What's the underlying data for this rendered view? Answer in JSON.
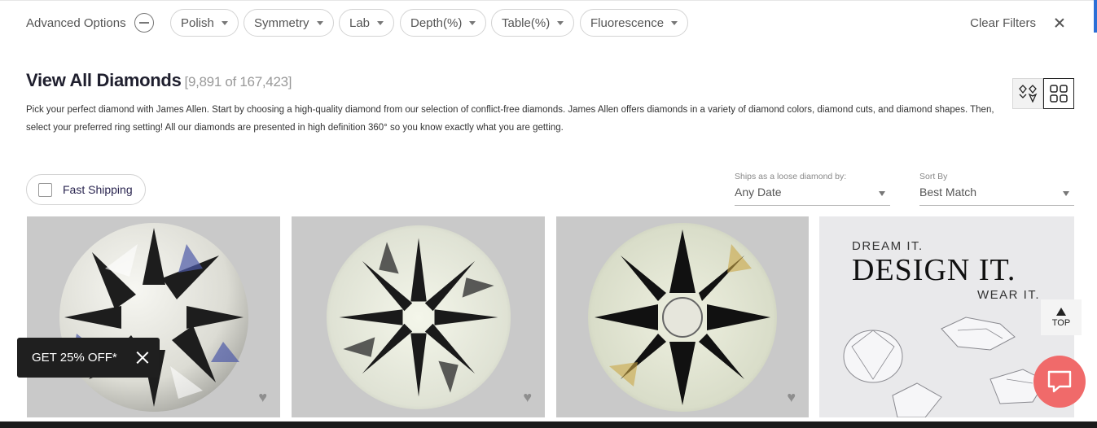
{
  "filters": {
    "advanced_label": "Advanced Options",
    "pills": [
      "Polish",
      "Symmetry",
      "Lab",
      "Depth(%)",
      "Table(%)",
      "Fluorescence"
    ],
    "clear_label": "Clear Filters"
  },
  "header": {
    "title": "View All Diamonds",
    "count": "[9,891 of 167,423]",
    "description": "Pick your perfect diamond with James Allen. Start by choosing a high-quality diamond from our selection of conflict-free diamonds. James Allen offers diamonds in a variety of diamond colors, diamond cuts, and diamond shapes. Then, select your preferred ring setting! All our diamonds are presented in high definition 360° so you know exactly what you are getting."
  },
  "toolbar": {
    "fast_shipping_label": "Fast Shipping",
    "ships_label": "Ships as a loose diamond by:",
    "ships_value": "Any Date",
    "sort_label": "Sort By",
    "sort_value": "Best Match"
  },
  "promo": {
    "line1": "DREAM IT.",
    "line2": "DESIGN IT.",
    "line3": "WEAR IT."
  },
  "top_button": {
    "label": "TOP"
  },
  "offer": {
    "label": "GET 25% OFF*"
  },
  "icons": {
    "minus": "minus-circle-icon",
    "caret": "chevron-down-icon",
    "close": "close-icon",
    "heart": "heart-icon",
    "chat": "chat-icon"
  },
  "colors": {
    "accent_blue": "#2c6fd6",
    "chat_bg": "#f06a6a",
    "offer_bg": "#1f1f1f"
  }
}
